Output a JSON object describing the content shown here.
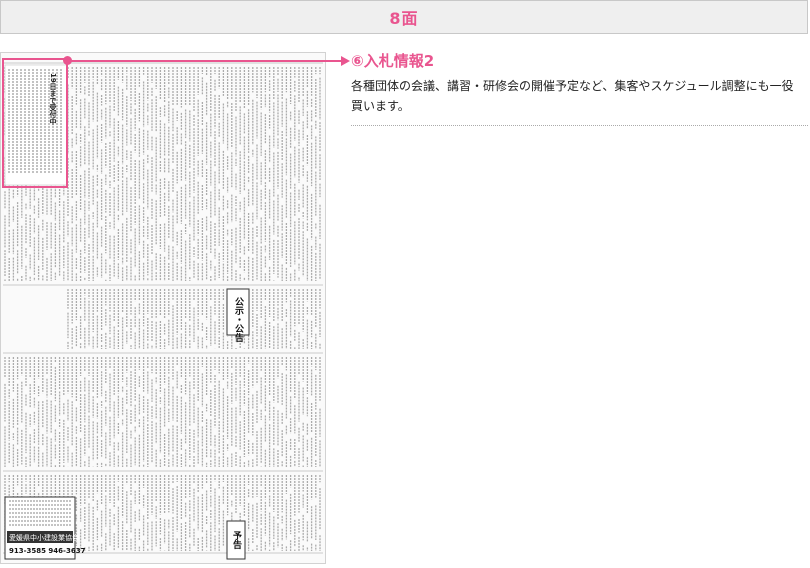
{
  "header": {
    "title": "8面"
  },
  "section": {
    "title": "⑥入札情報2",
    "description": "各種団体の会議、講習・研修会の開催予定など、集客やスケジュール調整にも一役買います。"
  },
  "paper": {
    "headline": "19日まで受付中",
    "box_label": "公示・公告",
    "notice_label": "予告",
    "footer_org": "愛媛県中小建設業協会",
    "footer_phone": "913-3585 946-3637"
  },
  "colors": {
    "accent": "#e9558f",
    "header_bg": "#efefef",
    "text": "#222222"
  }
}
